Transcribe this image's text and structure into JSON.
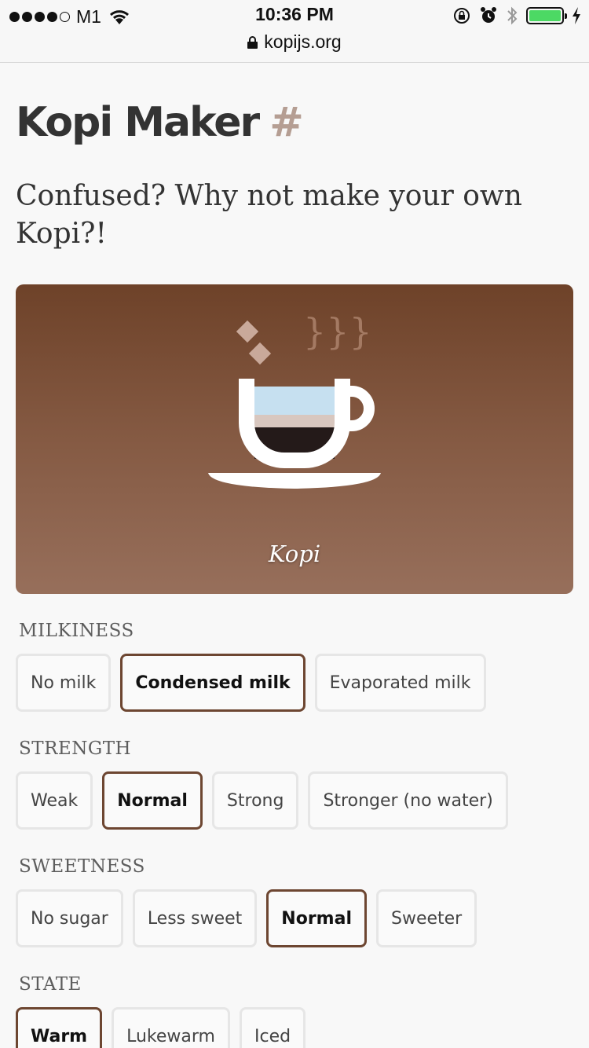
{
  "status_bar": {
    "carrier": "M1",
    "time": "10:36 PM",
    "url": "kopijs.org"
  },
  "page": {
    "title": "Kopi Maker",
    "anchor": "#",
    "subtitle": "Confused? Why not make your own Kopi?!"
  },
  "hero": {
    "drink_name": "Kopi",
    "steam_text": "}}}"
  },
  "groups": [
    {
      "label": "MILKINESS",
      "options": [
        {
          "label": "No milk",
          "selected": false
        },
        {
          "label": "Condensed milk",
          "selected": true
        },
        {
          "label": "Evaporated milk",
          "selected": false
        }
      ]
    },
    {
      "label": "STRENGTH",
      "options": [
        {
          "label": "Weak",
          "selected": false
        },
        {
          "label": "Normal",
          "selected": true
        },
        {
          "label": "Strong",
          "selected": false
        },
        {
          "label": "Stronger (no water)",
          "selected": false
        }
      ]
    },
    {
      "label": "SWEETNESS",
      "options": [
        {
          "label": "No sugar",
          "selected": false
        },
        {
          "label": "Less sweet",
          "selected": false
        },
        {
          "label": "Normal",
          "selected": true
        },
        {
          "label": "Sweeter",
          "selected": false
        }
      ]
    },
    {
      "label": "STATE",
      "options": [
        {
          "label": "Warm",
          "selected": true
        },
        {
          "label": "Lukewarm",
          "selected": false
        },
        {
          "label": "Iced",
          "selected": false
        }
      ]
    }
  ],
  "colors": {
    "accent": "#6d4631",
    "hash": "#b59e93",
    "battery": "#4cd964"
  }
}
